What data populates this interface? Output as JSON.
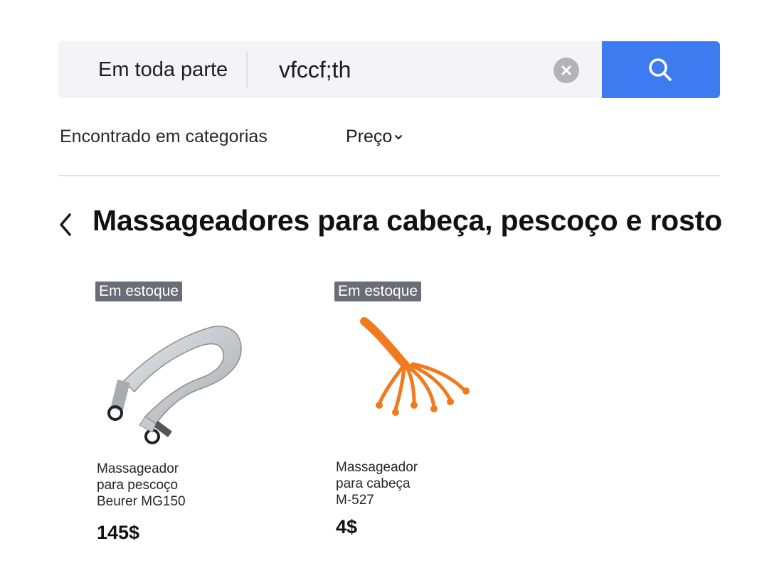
{
  "search": {
    "scope_label": "Em toda parte",
    "query": "vfccf;th"
  },
  "filters": {
    "categories_label": "Encontrado em categorias",
    "price_label": "Preço"
  },
  "page": {
    "title": "Massageadores para cabeça, pescoço e rosto"
  },
  "products": [
    {
      "badge": "Em estoque",
      "name_lines": [
        "Massageador",
        "para pescoço",
        "Beurer MG150"
      ],
      "price": "145$"
    },
    {
      "badge": "Em estoque",
      "name_lines": [
        "Massageador",
        "para cabeça",
        "M-527"
      ],
      "price": "4$"
    }
  ],
  "icons": {
    "clear": "close-circle-icon",
    "search": "search-icon",
    "price_dropdown": "chevron-down-icon",
    "back": "chevron-left-icon"
  },
  "colors": {
    "search_button": "#3f7bf0",
    "badge": "#6b6c78",
    "product2_accent": "#f07a1e"
  }
}
